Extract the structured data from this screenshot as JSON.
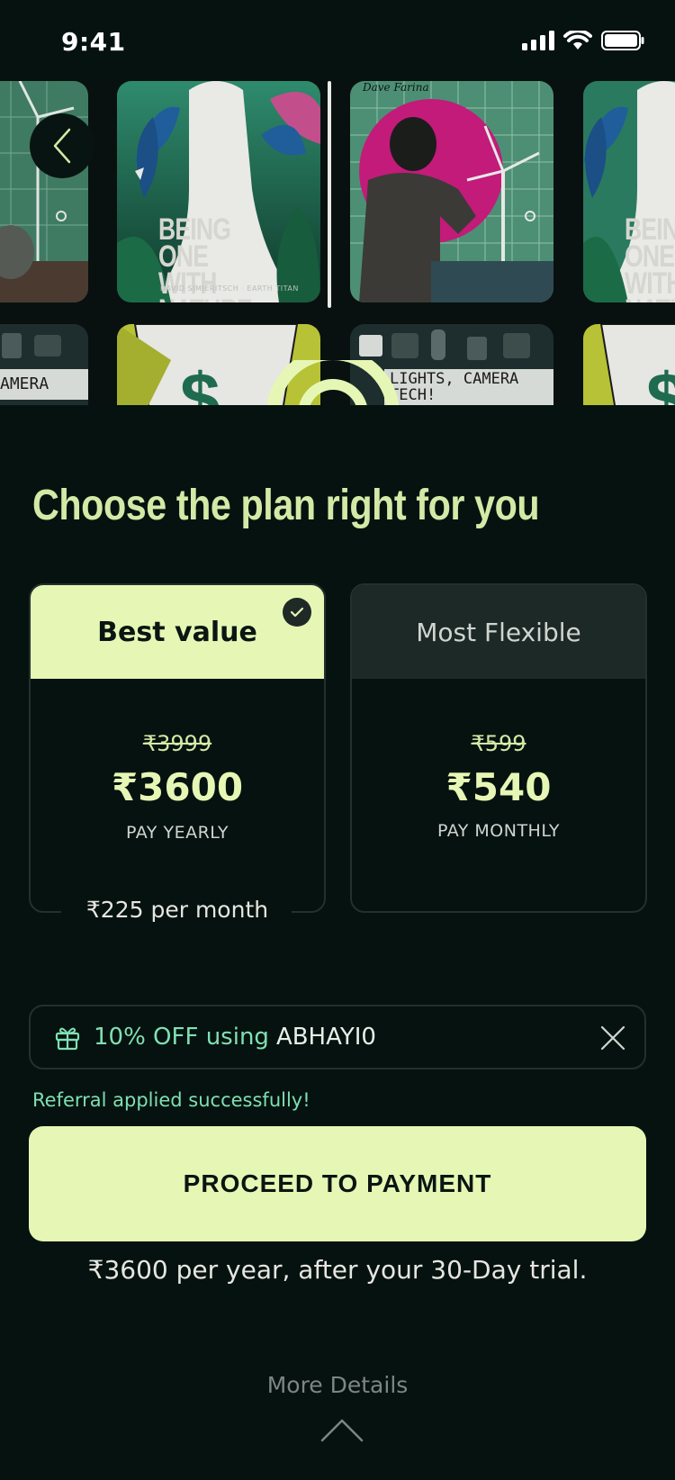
{
  "status_bar": {
    "time": "9:41"
  },
  "posters": {
    "title_line1": "BEING ONE",
    "title_line2": "WITH NATURE",
    "credit": "DAVID SIMIERITSCH · EARTH TITAN",
    "artist": "Dave Farina",
    "tech_sign_line1": "LIGHTS, CAMERA",
    "tech_sign_line2": "TECH!",
    "tech_sign_partial": "AMERA"
  },
  "sheet": {
    "title": "Choose the plan right for you",
    "plans": [
      {
        "header": "Best value",
        "original_price": "₹3999",
        "price": "₹3600",
        "period": "PAY YEARLY",
        "per_month": "₹225 per month",
        "selected": true
      },
      {
        "header": "Most Flexible",
        "original_price": "₹599",
        "price": "₹540",
        "period": "PAY MONTHLY",
        "selected": false
      }
    ],
    "coupon": {
      "discount_text": "10% OFF using",
      "code": "ABHAYI0"
    },
    "referral_message": "Referral applied successfully!",
    "proceed_label": "PROCEED TO PAYMENT",
    "trial_note": "₹3600 per year, after your 30-Day trial.",
    "more_details": "More Details"
  },
  "colors": {
    "accent": "#e6f7b5",
    "title": "#d3e9a6",
    "mint": "#7fe0b2",
    "background": "#061210"
  }
}
